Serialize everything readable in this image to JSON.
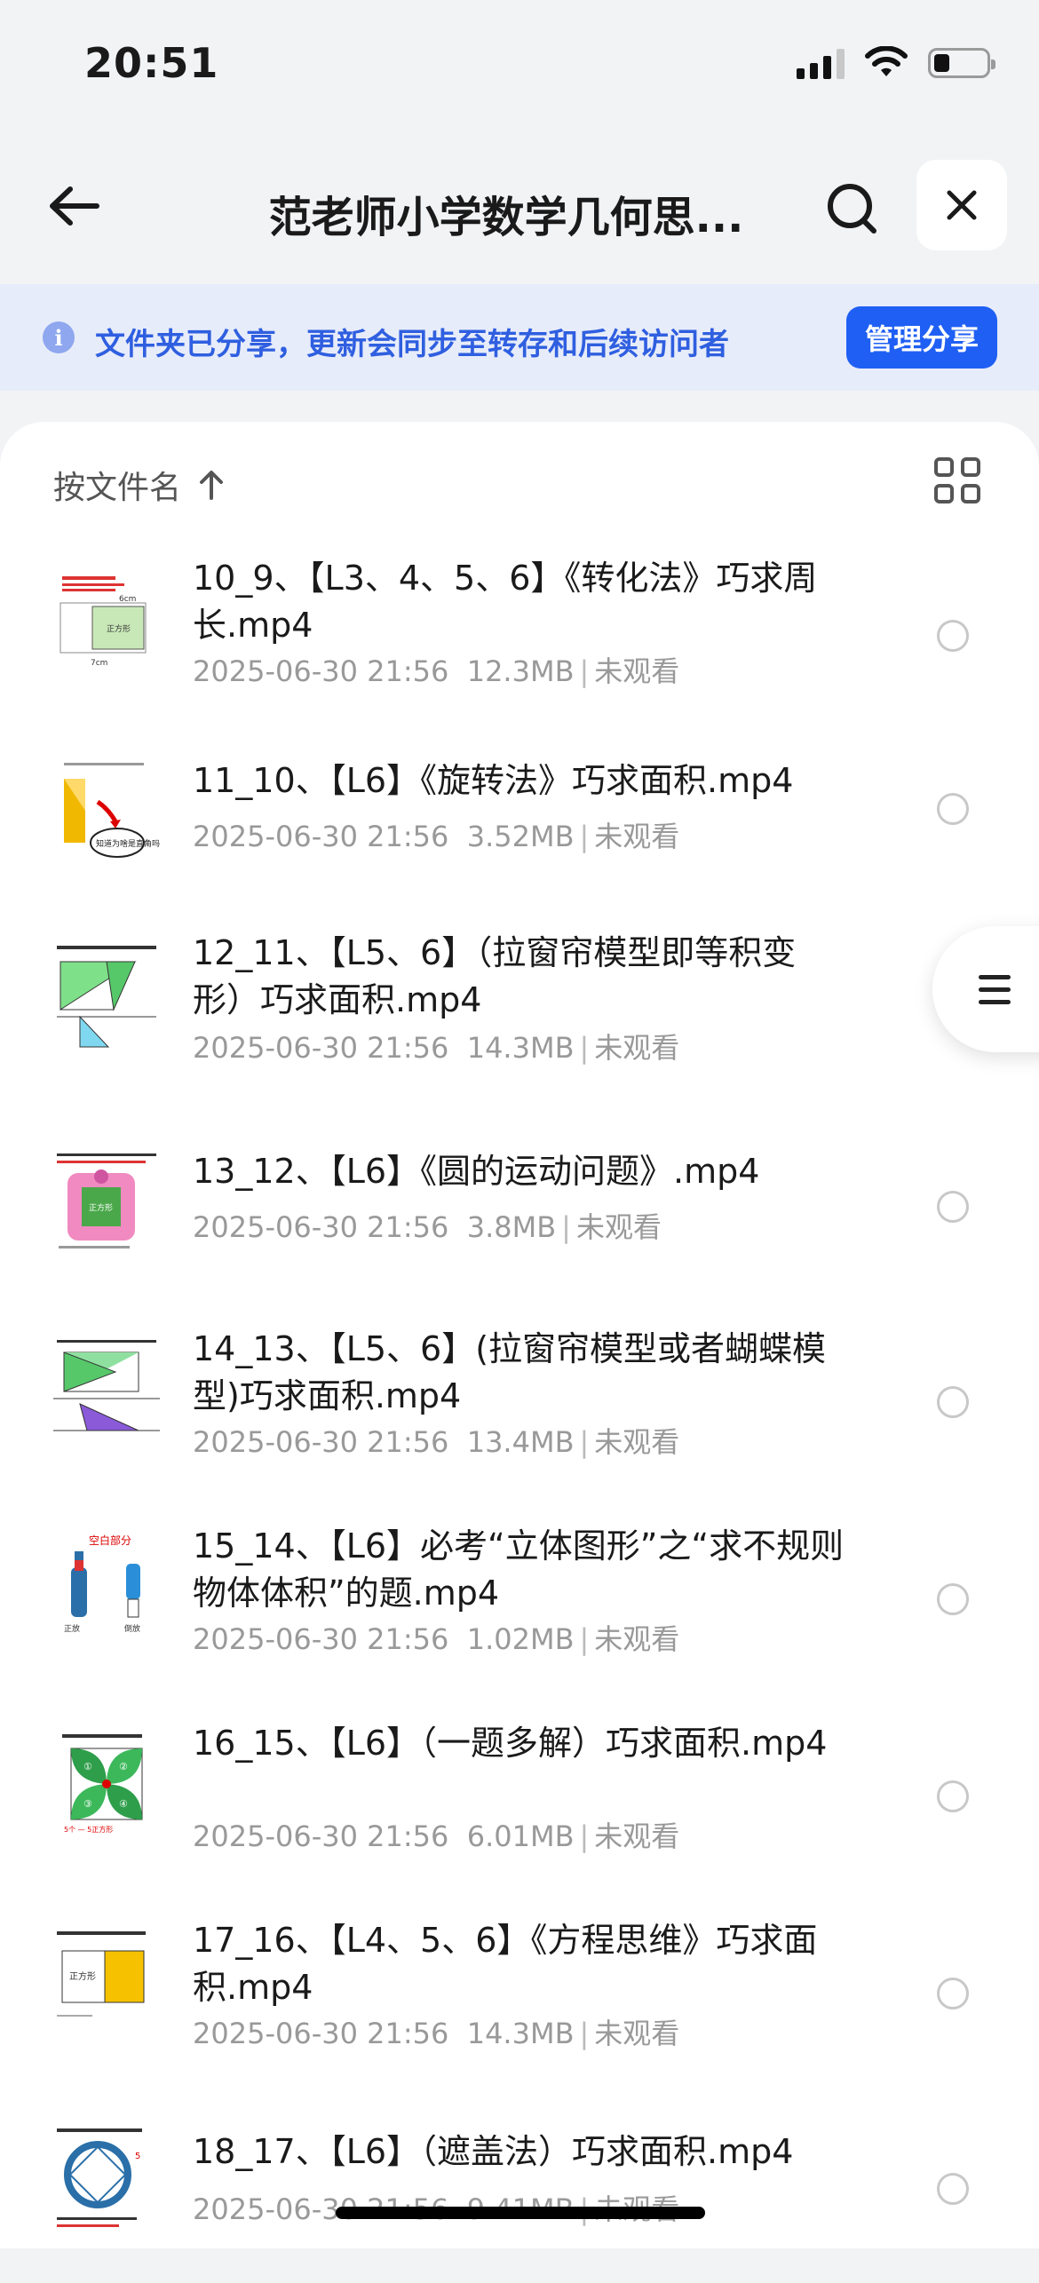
{
  "status": {
    "time": "20:51"
  },
  "nav": {
    "title": "范老师小学数学几何思..."
  },
  "banner": {
    "text": "文件夹已分享，更新会同步至转存和后续访问者",
    "manage_label": "管理分享"
  },
  "sort": {
    "label": "按文件名"
  },
  "files": [
    {
      "name": "10_9、【L3、4、5、6】《转化法》巧求周长.mp4",
      "date": "2025-06-30 21:56",
      "size": "12.3MB",
      "status": "未观看"
    },
    {
      "name": "11_10、【L6】《旋转法》巧求面积.mp4",
      "date": "2025-06-30 21:56",
      "size": "3.52MB",
      "status": "未观看"
    },
    {
      "name": "12_11、【L5、6】（拉窗帘模型即等积变形）巧求面积.mp4",
      "date": "2025-06-30 21:56",
      "size": "14.3MB",
      "status": "未观看"
    },
    {
      "name": "13_12、【L6】《圆的运动问题》.mp4",
      "date": "2025-06-30 21:56",
      "size": "3.8MB",
      "status": "未观看"
    },
    {
      "name": "14_13、【L5、6】(拉窗帘模型或者蝴蝶模型)巧求面积.mp4",
      "date": "2025-06-30 21:56",
      "size": "13.4MB",
      "status": "未观看"
    },
    {
      "name": "15_14、【L6】必考“立体图形”之“求不规则物体体积”的题.mp4",
      "date": "2025-06-30 21:56",
      "size": "1.02MB",
      "status": "未观看"
    },
    {
      "name": "16_15、【L6】（一题多解）巧求面积.mp4",
      "date": "2025-06-30 21:56",
      "size": "6.01MB",
      "status": "未观看"
    },
    {
      "name": "17_16、【L4、5、6】《方程思维》巧求面积.mp4",
      "date": "2025-06-30 21:56",
      "size": "14.3MB",
      "status": "未观看"
    },
    {
      "name": "18_17、【L6】（遮盖法）巧求面积.mp4",
      "date": "2025-06-30 21:56",
      "size": "9.41MB",
      "status": "未观看"
    }
  ],
  "thumb_texts": {
    "t0_a": "6cm",
    "t0_b": "正方形",
    "t0_c": "7cm",
    "t1_a": "知道为啥是直角吗",
    "t3_a": "正方形",
    "t5_a": "空白部分",
    "t5_b": "正放",
    "t5_c": "倒放",
    "t6_a": "①",
    "t6_b": "②",
    "t6_c": "③",
    "t6_d": "④",
    "t6_e": "5个 — 5正方形",
    "t7_a": "正方形",
    "t8_a": "5"
  },
  "colors": {
    "accent": "#1f5ff4",
    "banner_bg": "#e7ecfa",
    "banner_text": "#2f5fe0"
  }
}
